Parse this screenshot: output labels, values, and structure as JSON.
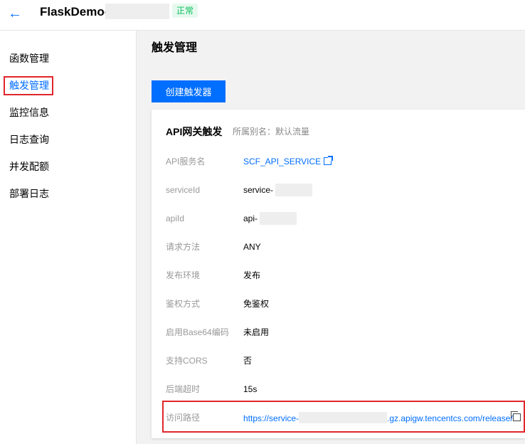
{
  "header": {
    "back_icon": "arrow-left-icon",
    "title": "FlaskDemo-",
    "status": "正常"
  },
  "sidebar": {
    "items": [
      {
        "label": "函数管理",
        "active": false
      },
      {
        "label": "触发管理",
        "active": true
      },
      {
        "label": "监控信息",
        "active": false
      },
      {
        "label": "日志查询",
        "active": false
      },
      {
        "label": "并发配额",
        "active": false
      },
      {
        "label": "部署日志",
        "active": false
      }
    ]
  },
  "main": {
    "title": "触发管理",
    "create_button": "创建触发器",
    "card": {
      "title": "API网关触发",
      "alias": "所属别名：默认流量",
      "rows": [
        {
          "label": "API服务名",
          "value": "SCF_API_SERVICE"
        },
        {
          "label": "serviceId",
          "value": "service-"
        },
        {
          "label": "apiId",
          "value": "api-"
        },
        {
          "label": "请求方法",
          "value": "ANY"
        },
        {
          "label": "发布环境",
          "value": "发布"
        },
        {
          "label": "鉴权方式",
          "value": "免鉴权"
        },
        {
          "label": "启用Base64编码",
          "value": "未启用"
        },
        {
          "label": "支持CORS",
          "value": "否"
        },
        {
          "label": "后端超时",
          "value": "15s"
        },
        {
          "label": "访问路径",
          "value_prefix": "https://service-",
          "value_suffix": ".gz.apigw.tencentcs.com/release/"
        }
      ]
    }
  },
  "colors": {
    "primary": "#006eff",
    "status": "#0abf5b",
    "highlight": "#e0262b"
  }
}
